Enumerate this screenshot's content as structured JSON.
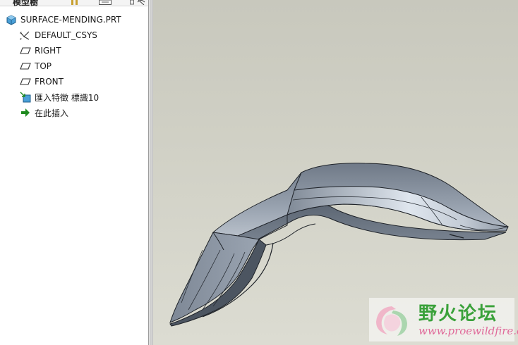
{
  "tree": {
    "header_title": "模型樹",
    "items": [
      {
        "label": "SURFACE-MENDING.PRT",
        "icon": "part-icon"
      },
      {
        "label": "DEFAULT_CSYS",
        "icon": "csys-icon"
      },
      {
        "label": "RIGHT",
        "icon": "datum-plane-icon"
      },
      {
        "label": "TOP",
        "icon": "datum-plane-icon"
      },
      {
        "label": "FRONT",
        "icon": "datum-plane-icon"
      },
      {
        "label": "匯入特徵 標識10",
        "icon": "import-feature-icon"
      },
      {
        "label": "在此插入",
        "icon": "insert-here-arrow-icon"
      }
    ]
  },
  "watermark": {
    "title": "野火论坛",
    "url": "www.proewildfire.cn"
  },
  "colors": {
    "viewport_bg": "#cfcfc4",
    "model_surface": "#8a95a3",
    "model_edge": "#1e2228",
    "insert_arrow": "#1f8a1f",
    "watermark_title": "#3aa13a",
    "watermark_url": "#e06a9a"
  }
}
